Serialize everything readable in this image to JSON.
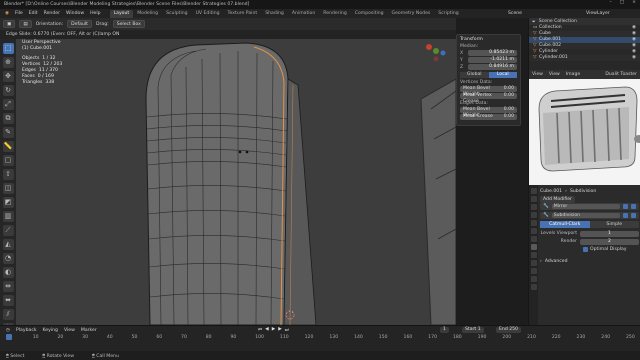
{
  "titlebar": {
    "text": "Blender* [D:\\Online Courses\\Blender Modeling Strategies\\Blender Scene Files\\Blender Strategies 07.blend]",
    "controls": [
      "–",
      "□",
      "×"
    ]
  },
  "menu": {
    "items": [
      "File",
      "Edit",
      "Render",
      "Window",
      "Help"
    ],
    "workspaces": [
      "Layout",
      "Modeling",
      "Sculpting",
      "UV Editing",
      "Texture Paint",
      "Shading",
      "Animation",
      "Rendering",
      "Compositing",
      "Geometry Nodes",
      "Scripting"
    ],
    "active_workspace": "Layout",
    "scene": "Scene",
    "view_layer": "ViewLayer"
  },
  "viewport_header": {
    "orientation_label": "Orientation:",
    "orientation_value": "Default",
    "drag_label": "Drag:",
    "drag_value": "Select Box"
  },
  "tooltip_line": "Edge Slide: 0.6770 (Even: OFF, Alt or (C)lamp ON",
  "viewport": {
    "view_name": "User Perspective",
    "object_name": "(1) Cube.001",
    "stats": [
      {
        "label": "Objects",
        "value": "1 / 32"
      },
      {
        "label": "Vertices",
        "value": "12 / 203"
      },
      {
        "label": "Edges",
        "value": "11 / 370"
      },
      {
        "label": "Faces",
        "value": "0 / 169"
      },
      {
        "label": "Triangles",
        "value": "338"
      }
    ]
  },
  "transform_panel": {
    "title": "Transform",
    "median_label": "Median:",
    "axes": [
      {
        "axis": "X",
        "value": "0.85423 m"
      },
      {
        "axis": "Y",
        "value": "-1.0211 m"
      },
      {
        "axis": "Z",
        "value": "0.84916 m"
      }
    ],
    "toggle": [
      "Global",
      "Local"
    ],
    "toggle_active": "Local",
    "vertices_data_label": "Vertices Data:",
    "vertex_props": [
      {
        "name": "Mean Bevel Weight",
        "value": "0.00"
      },
      {
        "name": "Mean Vertex Crease",
        "value": "0.00"
      }
    ],
    "edges_data_label": "Edges Data:",
    "edge_props": [
      {
        "name": "Mean Bevel Weight",
        "value": "0.00"
      },
      {
        "name": "Mean Crease",
        "value": "0.00"
      }
    ]
  },
  "outliner": {
    "header": "Scene Collection",
    "items": [
      {
        "name": "Collection"
      },
      {
        "name": "Cube"
      },
      {
        "name": "Cube.001"
      },
      {
        "name": "Cube.002"
      },
      {
        "name": "Cylinder"
      },
      {
        "name": "Cylinder.001"
      }
    ]
  },
  "image_editor": {
    "menu": [
      "View",
      "View",
      "Image"
    ],
    "image_name": "Dualit Toaster"
  },
  "properties": {
    "object": "Cube.001",
    "modifier_path": "Subdivision",
    "add_modifier": "Add Modifier",
    "modifiers": [
      "Mirror",
      "Subdivision"
    ],
    "subdiv_types": [
      "Catmull-Clark",
      "Simple"
    ],
    "subdiv_active": "Catmull-Clark",
    "levels_viewport_label": "Levels Viewport",
    "levels_viewport": "1",
    "render_label": "Render",
    "render": "2",
    "optimal_display": "Optimal Display",
    "advanced": "Advanced"
  },
  "timeline": {
    "menu": [
      "Playback",
      "Keying",
      "View",
      "Marker"
    ],
    "current_frame": "1",
    "start_label": "Start",
    "start": "1",
    "end_label": "End",
    "end": "250",
    "ticks": [
      "1",
      "10",
      "20",
      "30",
      "40",
      "50",
      "60",
      "70",
      "80",
      "90",
      "100",
      "110",
      "120",
      "130",
      "140",
      "150",
      "160",
      "170",
      "180",
      "190",
      "200",
      "210",
      "220",
      "230",
      "240",
      "250"
    ]
  },
  "statusbar": [
    "Select",
    "Rotate View",
    "Call Menu"
  ],
  "colors": {
    "accent": "#4772b3",
    "object_orange": "#e19447",
    "viewport_bg": "#3e3e3e"
  }
}
